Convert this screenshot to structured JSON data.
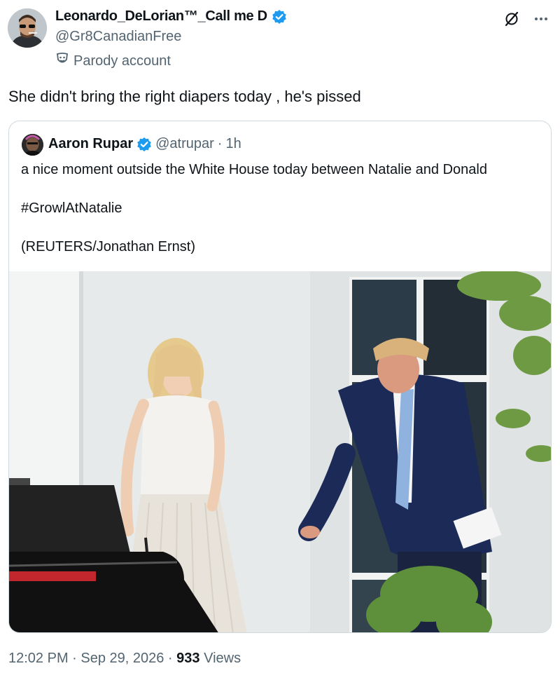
{
  "tweet": {
    "author": {
      "display_name": "Leonardo_DeLorian™_Call me D",
      "handle": "@Gr8CanadianFree",
      "label": "Parody account"
    },
    "text": "She didn't bring the right diapers today , he's pissed",
    "timestamp": "12:02 PM · Sep 29, 2026 · ",
    "views_count": "933",
    "views_label": " Views"
  },
  "quote": {
    "author": {
      "display_name": "Aaron Rupar",
      "handle": "@atrupar",
      "time": "1h"
    },
    "lines": [
      "a nice moment outside the White House today between Natalie and Donald",
      "#GrowlAtNatalie",
      "(REUTERS/Jonathan Ernst)"
    ]
  },
  "colors": {
    "verified": "#1d9bf0",
    "secondary_text": "#536471",
    "border": "#cfd9de"
  },
  "icons": [
    "verified-badge-icon",
    "parody-mask-icon",
    "grok-icon",
    "more-icon"
  ]
}
